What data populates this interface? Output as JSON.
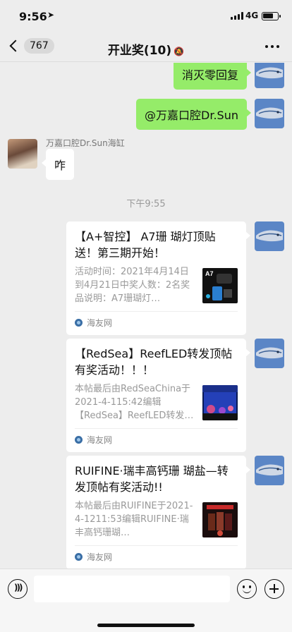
{
  "status_bar": {
    "time": "9:56",
    "network": "4G",
    "battery_level": 0.75,
    "icons": [
      "location-arrow-icon",
      "signal-bars-icon",
      "battery-icon"
    ]
  },
  "nav": {
    "back_count": "767",
    "title": "开业奖(10)",
    "mute_icon": "🔕",
    "icons": [
      "back-chevron-icon",
      "mute-bell-icon",
      "more-dots-icon"
    ]
  },
  "messages": {
    "self_1": "消灭零回复",
    "self_2": "@万嘉口腔Dr.Sun",
    "other_sender": "万嘉口腔Dr.Sun海缸",
    "other_text": "咋",
    "timestamp": "下午9:55"
  },
  "cards": [
    {
      "title": "【A+智控】 A7珊 瑚灯顶贴送！第三期开始！",
      "desc": "活动时间：2021年4月14日到4月21日中奖人数：2名奖品说明：A7珊瑚灯…",
      "source": "海友网",
      "thumb_label": "A7"
    },
    {
      "title": "【RedSea】ReefLED转发顶帖有奖活动！！！",
      "desc": "本帖最后由RedSeaChina于2021-4-115:42编辑【RedSea】ReefLED转发…",
      "source": "海友网"
    },
    {
      "title": "RUIFINE·瑞丰高钙珊 瑚盐—转发顶帖有奖活动!!",
      "desc": "本帖最后由RUIFINE于2021-4-1211:53编辑RUIFINE·瑞丰高钙珊瑚…",
      "source": "海友网"
    }
  ],
  "input_bar": {
    "icons": [
      "voice-icon",
      "emoji-icon",
      "plus-icon"
    ]
  },
  "colors": {
    "background": "#ededed",
    "self_bubble": "#95ec69",
    "avatar_blue": "#5b86c6"
  }
}
